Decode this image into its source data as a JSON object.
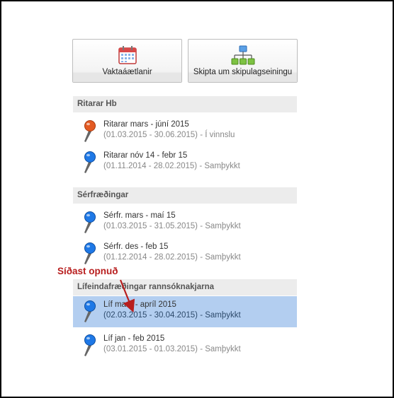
{
  "tiles": [
    {
      "label": "Vaktaáætlanir",
      "icon": "calendar-icon"
    },
    {
      "label": "Skipta um skipulagseiningu",
      "icon": "org-chart-icon"
    }
  ],
  "sections": [
    {
      "title": "Ritarar Hb",
      "items": [
        {
          "name": "Ritarar mars - júní 2015",
          "dates": "(01.03.2015 - 30.06.2015)",
          "status": "Í vinnslu",
          "pin_color": "#e35a22"
        },
        {
          "name": "Ritarar nóv 14 - febr 15",
          "dates": "(01.11.2014 - 28.02.2015)",
          "status": "Samþykkt",
          "pin_color": "#1e78e6"
        }
      ]
    },
    {
      "title": "Sérfræðingar",
      "items": [
        {
          "name": "Sérfr. mars - maí 15",
          "dates": "(01.03.2015 - 31.05.2015)",
          "status": "Samþykkt",
          "pin_color": "#1e78e6"
        },
        {
          "name": "Sérfr. des - feb 15",
          "dates": "(01.12.2014 - 28.02.2015)",
          "status": "Samþykkt",
          "pin_color": "#1e78e6"
        }
      ]
    },
    {
      "title": "Lífeindafræðingar rannsóknakjarna",
      "items": [
        {
          "name": "Líf mars - apríl 2015",
          "dates": "(02.03.2015 - 30.04.2015)",
          "status": "Samþykkt",
          "pin_color": "#1e78e6",
          "selected": true
        },
        {
          "name": "Líf jan - feb 2015",
          "dates": "(03.01.2015 - 01.03.2015)",
          "status": "Samþykkt",
          "pin_color": "#1e78e6"
        }
      ]
    }
  ],
  "annotation": {
    "text": "Síðast opnuð",
    "color": "#b81e1e"
  },
  "separator": " - "
}
